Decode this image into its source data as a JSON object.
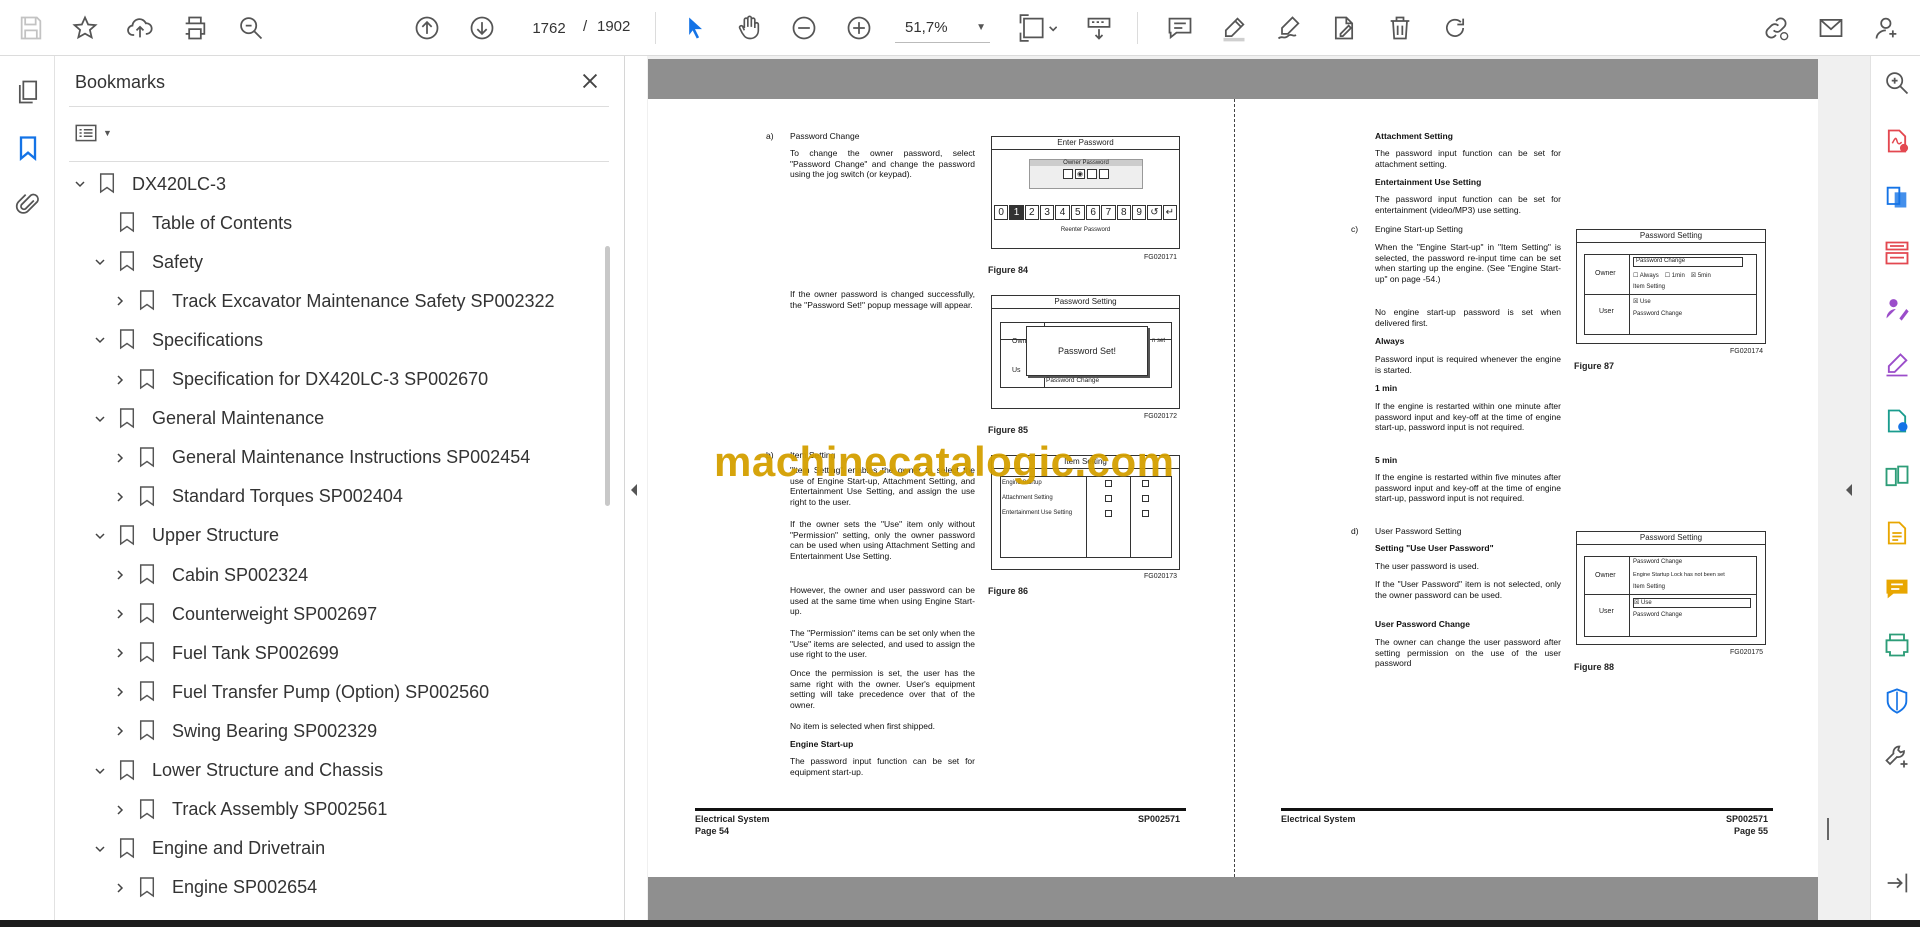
{
  "toolbar": {
    "current_page": "1762",
    "page_separator": "/",
    "total_pages": "1902",
    "zoom": "51,7%"
  },
  "bookmarks": {
    "title": "Bookmarks",
    "items": [
      {
        "label": "DX420LC-3",
        "level": 0,
        "expanded": true
      },
      {
        "label": "Table of Contents",
        "level": 1,
        "leaf": true
      },
      {
        "label": "Safety",
        "level": 1,
        "expanded": true
      },
      {
        "label": "Track Excavator Maintenance Safety SP002322",
        "level": 2
      },
      {
        "label": "Specifications",
        "level": 1,
        "expanded": true
      },
      {
        "label": "Specification for DX420LC-3 SP002670",
        "level": 2
      },
      {
        "label": "General Maintenance",
        "level": 1,
        "expanded": true
      },
      {
        "label": "General Maintenance Instructions SP002454",
        "level": 2
      },
      {
        "label": "Standard Torques SP002404",
        "level": 2
      },
      {
        "label": "Upper Structure",
        "level": 1,
        "expanded": true
      },
      {
        "label": "Cabin SP002324",
        "level": 2
      },
      {
        "label": "Counterweight SP002697",
        "level": 2
      },
      {
        "label": "Fuel Tank SP002699",
        "level": 2
      },
      {
        "label": "Fuel Transfer Pump (Option) SP002560",
        "level": 2
      },
      {
        "label": "Swing Bearing SP002329",
        "level": 2
      },
      {
        "label": "Lower Structure and Chassis",
        "level": 1,
        "expanded": true
      },
      {
        "label": "Track Assembly SP002561",
        "level": 2
      },
      {
        "label": "Engine and Drivetrain",
        "level": 1,
        "expanded": true
      },
      {
        "label": "Engine SP002654",
        "level": 2
      }
    ]
  },
  "doc": {
    "left": {
      "a_label": "a)",
      "a_head": "Password Change",
      "a_text": "To change the owner password, select \"Password Change\" and change the password using the jog switch (or keypad).",
      "a2_text": "If the owner password is changed successfully, the \"Password Set!\" popup message will appear.",
      "b_label": "b)",
      "b_head": "Item Setting",
      "b_text1": "\"Item Setting\" enables the owner to select the use of Engine Start-up, Attachment Setting, and Entertainment Use Setting, and assign the use right to the user.",
      "b_text2": "If the owner sets the \"Use\" item only without \"Permission\" setting, only the owner password can be used when using Attachment Setting and Entertainment Use Setting.",
      "b_text3": "However, the owner and user password can be used at the same time when using Engine Start-up.",
      "b_text4": "The \"Permission\" items can be set only when the \"Use\" items are selected, and used to assign the use right to the user.",
      "b_text5": "Once the permission is set, the user has the same right with the owner. User's equipment setting will take precedence over that of the owner.",
      "b_text6": "No item is selected when first shipped.",
      "b_sub": "Engine Start-up",
      "b_text7": "The password input function can be set for equipment start-up.",
      "fig84": {
        "title": "Enter Password",
        "inner": "Owner Password",
        "keys": [
          "0",
          "1",
          "2",
          "3",
          "4",
          "5",
          "6",
          "7",
          "8",
          "9",
          "↺",
          "↵"
        ],
        "bottom": "Reenter Password",
        "code": "FG020171",
        "label": "Figure 84"
      },
      "fig85": {
        "title": "Password Setting",
        "popup": "Password Set!",
        "row": "Password Change",
        "side1": "Own",
        "side2": "Us",
        "side3": "n set",
        "code": "FG020172",
        "label": "Figure 85"
      },
      "fig86": {
        "title": "Item Setting",
        "rows": [
          "Engine Startup",
          "Attachment Setting",
          "Entertainment Use Setting"
        ],
        "code": "FG020173",
        "label": "Figure 86"
      },
      "footer_left": "Electrical System",
      "footer_page": "Page 54",
      "footer_code": "SP002571"
    },
    "right": {
      "att_head": "Attachment Setting",
      "att_text": "The password input function can be set for attachment setting.",
      "ent_head": "Entertainment Use Setting",
      "ent_text": "The password input function can be set for entertainment (video/MP3) use setting.",
      "c_label": "c)",
      "c_head": "Engine Start-up Setting",
      "c_text1": "When the \"Engine Start-up\" in \"Item Setting\" is selected, the password re-input time can be set when starting up the engine. (See \"Engine Start-up\" on page -54.)",
      "c_text2": "No engine start-up password is set when delivered first.",
      "always_head": "Always",
      "always_text": "Password input is required whenever the engine is started.",
      "m1_head": "1 min",
      "m1_text": "If the engine is restarted within one minute after password input and key-off at the time of engine start-up, password input is not required.",
      "m5_head": "5 min",
      "m5_text": "If the engine is restarted within five minutes after password input and key-off at the time of engine start-up, password input is not required.",
      "d_label": "d)",
      "d_head": "User Password Setting",
      "d_sub1": "Setting \"Use User Password\"",
      "d_text1": "The user password is used.",
      "d_text2": "If the \"User Password\" item is not selected, only the owner password can be used.",
      "d_sub2": "User Password Change",
      "d_text3": "The owner can change the user password after setting permission on the use of the user password",
      "fig87": {
        "title": "Password Setting",
        "owner": "Owner",
        "user": "User",
        "r1": "Password Change",
        "o1": "Always",
        "o2": "1min",
        "o3": "5min",
        "r3": "Item Setting",
        "r4": "Use",
        "r5": "Password Change",
        "code": "FG020174",
        "label": "Figure 87"
      },
      "fig88": {
        "title": "Password Setting",
        "owner": "Owner",
        "user": "User",
        "r1": "Password Change",
        "r2": "Engine Startup Lock has not been set",
        "r3": "Item Setting",
        "r4": "Use",
        "r5": "Password Change",
        "code": "FG020175",
        "label": "Figure 88"
      },
      "footer_left": "Electrical System",
      "footer_page": "Page 55",
      "footer_code": "SP002571"
    },
    "watermark": "machinecatalogic.com"
  },
  "colors": {
    "accent": "#1473e6",
    "redtool": "#e34850",
    "purple": "#9b4dca",
    "watermark": "#d4a000"
  }
}
